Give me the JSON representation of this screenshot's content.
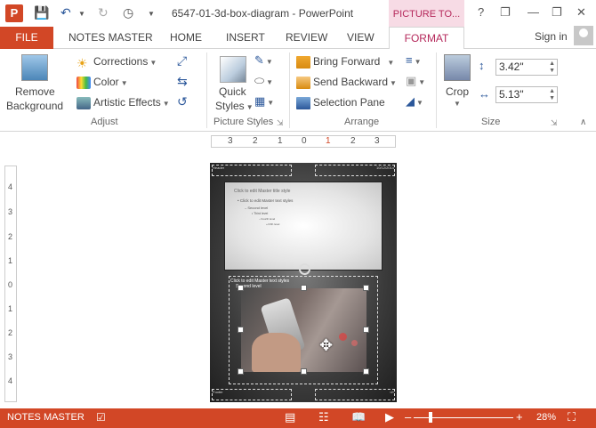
{
  "titlebar": {
    "app_letter": "P",
    "document_title": "6547-01-3d-box-diagram - PowerPoint",
    "context_tab": "PICTURE TO...",
    "help": "?"
  },
  "tabs": {
    "file": "FILE",
    "notes_master": "NOTES MASTER",
    "home": "HOME",
    "insert": "INSERT",
    "review": "REVIEW",
    "view": "VIEW",
    "format": "FORMAT",
    "sign_in": "Sign in"
  },
  "ribbon": {
    "adjust": {
      "label": "Adjust",
      "remove_background": "Remove Background",
      "corrections": "Corrections",
      "color": "Color",
      "artistic_effects": "Artistic Effects"
    },
    "picture_styles": {
      "label": "Picture Styles",
      "quick_styles": "Quick Styles"
    },
    "arrange": {
      "label": "Arrange",
      "bring_forward": "Bring Forward",
      "send_backward": "Send Backward",
      "selection_pane": "Selection Pane"
    },
    "size": {
      "label": "Size",
      "crop": "Crop",
      "height": "3.42\"",
      "width": "5.13\""
    }
  },
  "ruler": {
    "h_ticks": [
      "3",
      "2",
      "1",
      "0",
      "1",
      "2",
      "3"
    ],
    "v_ticks": [
      "4",
      "3",
      "2",
      "1",
      "0",
      "1",
      "2",
      "3",
      "4"
    ]
  },
  "notes_page": {
    "slide_title": "Click to edit Master title style",
    "bullet1": "Click to edit Master text styles",
    "bullet2": "Second level",
    "bullet3": "Third level",
    "bullet4": "Fourth level",
    "bullet5": "Fifth level",
    "notes_text": "Click to edit Master text styles",
    "notes_level2": "Second level",
    "header": "Header",
    "date": "10/12/2014",
    "footer": "Footer"
  },
  "statusbar": {
    "mode": "NOTES MASTER",
    "zoom": "28%",
    "zoom_level": 0.28
  },
  "colors": {
    "accent": "#d24726",
    "context": "#b5285b"
  }
}
